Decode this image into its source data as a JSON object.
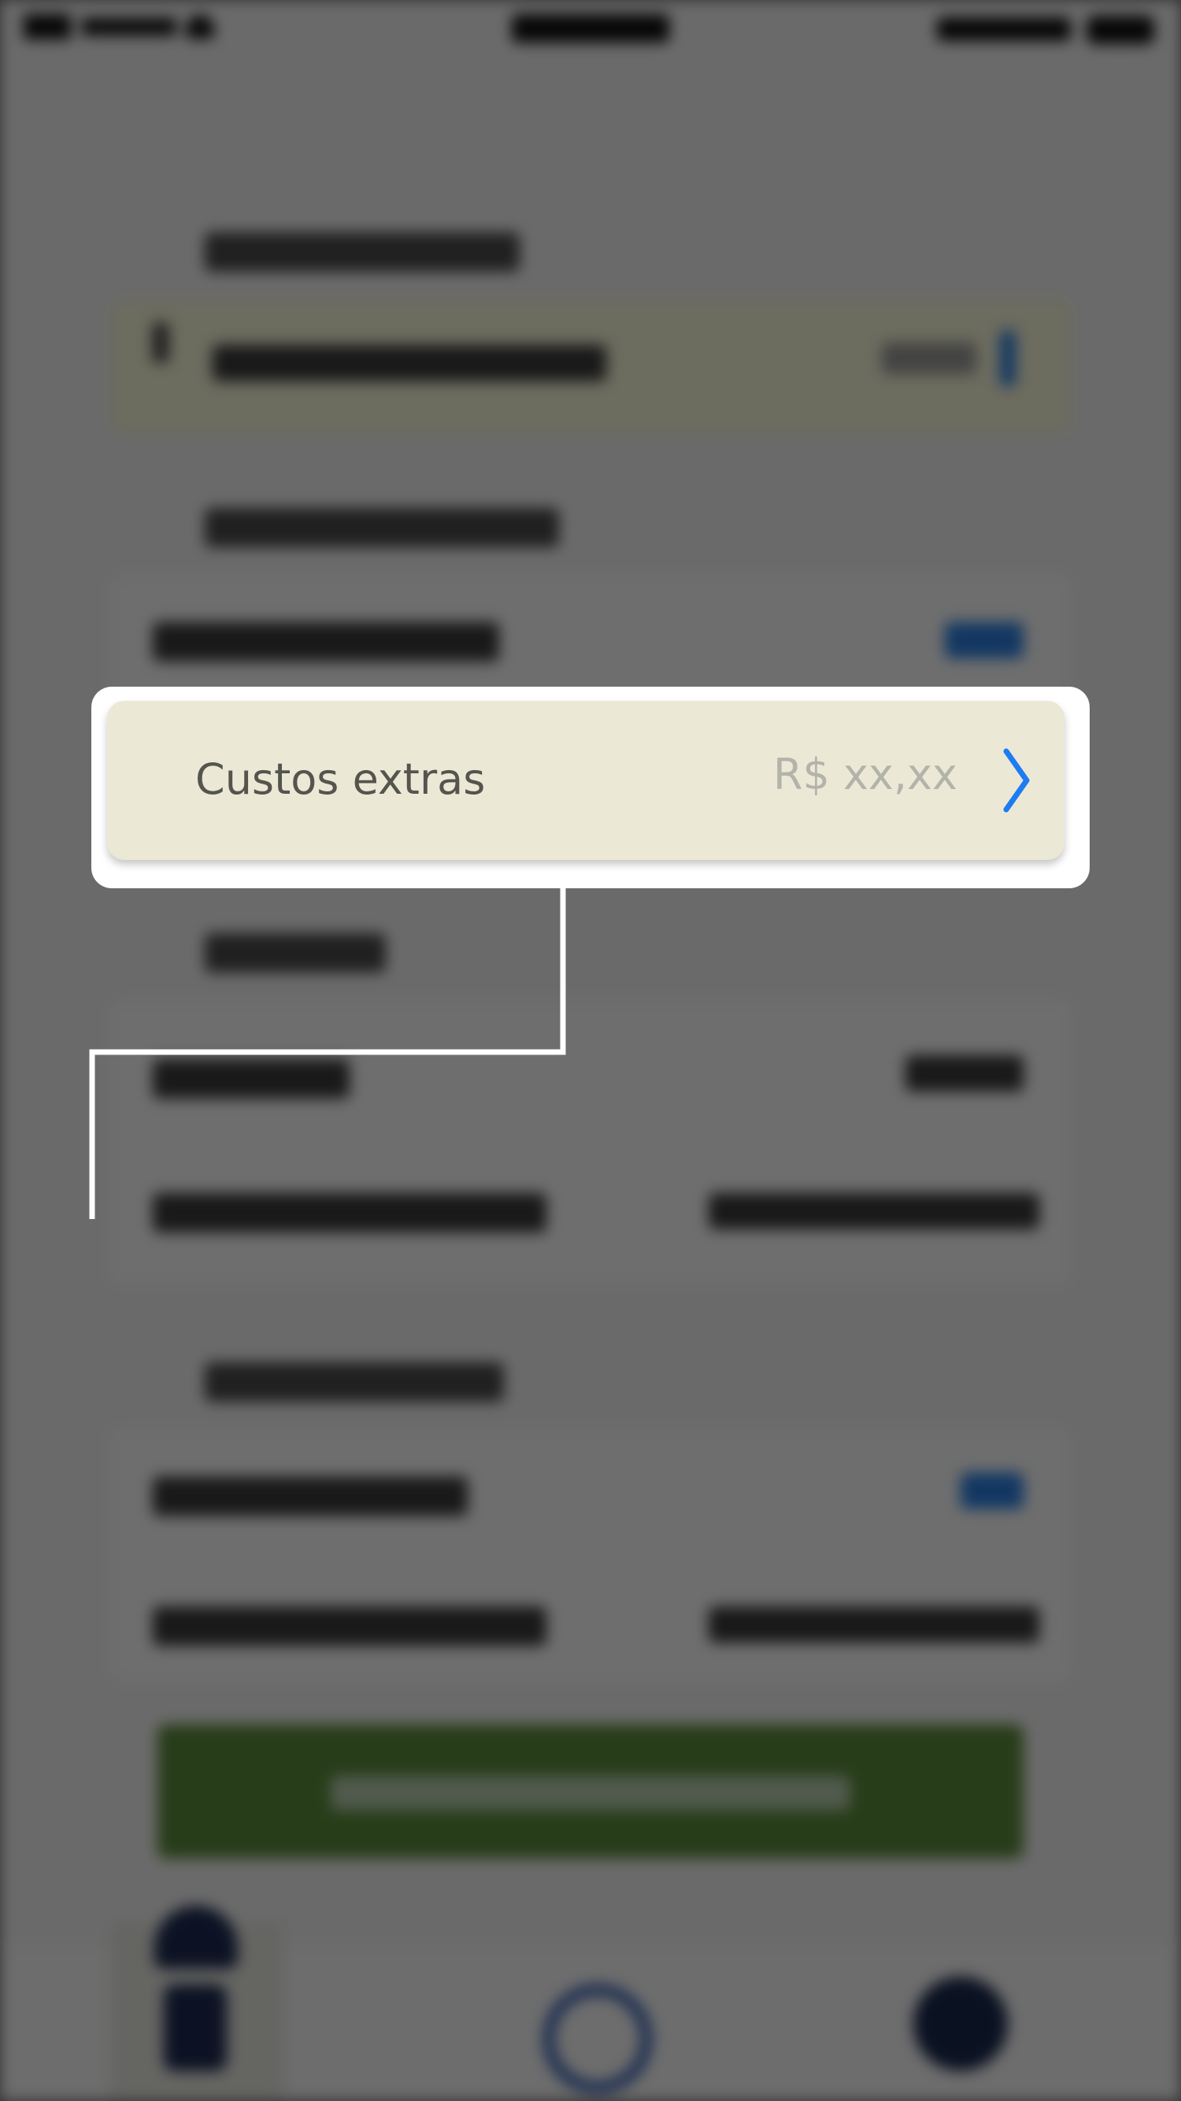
{
  "highlight": {
    "label": "Custos extras",
    "value": "R$ xx,xx"
  },
  "icons": {
    "row_chevron": "chevron-right-icon",
    "tab_1": "document-icon",
    "tab_2": "search-icon",
    "tab_3": "profile-icon"
  },
  "colors": {
    "accent_blue": "#1d7cf2",
    "highlight_row_bg": "#ebe9d6",
    "callout_outline": "#ffffff",
    "button_green": "#5a8a3a"
  }
}
